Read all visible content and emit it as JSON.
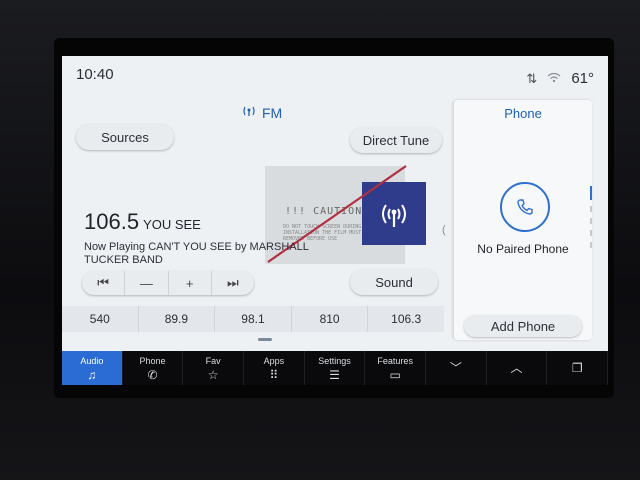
{
  "status": {
    "time": "10:40",
    "temperature": "61°"
  },
  "radio": {
    "band": "FM",
    "sources_label": "Sources",
    "direct_tune_label": "Direct Tune",
    "frequency": "106.5",
    "station_name": "YOU SEE",
    "now_playing": "Now Playing CAN'T YOU SEE by MARSHALL TUCKER BAND",
    "sound_label": "Sound",
    "transport": {
      "prev": "⏮",
      "minus": "—",
      "plus": "+",
      "next": "⏭"
    },
    "presets": [
      "540",
      "89.9",
      "98.1",
      "810",
      "106.3"
    ]
  },
  "sticker": {
    "caution": "!!! CAUTION !!!",
    "fine_print": "DO NOT TOUCH SCREEN DURING INSTALLATION THE FILM MUST BE REMOVED BEFORE USE"
  },
  "phone": {
    "title": "Phone",
    "status": "No Paired Phone",
    "add_label": "Add Phone"
  },
  "nav": {
    "audio": "Audio",
    "phone": "Phone",
    "fav": "Fav",
    "apps": "Apps",
    "settings": "Settings",
    "features": "Features"
  },
  "colors": {
    "accent": "#2a6cd4",
    "text_blue": "#1f5fb8",
    "art_bg": "#2f3c8c"
  }
}
